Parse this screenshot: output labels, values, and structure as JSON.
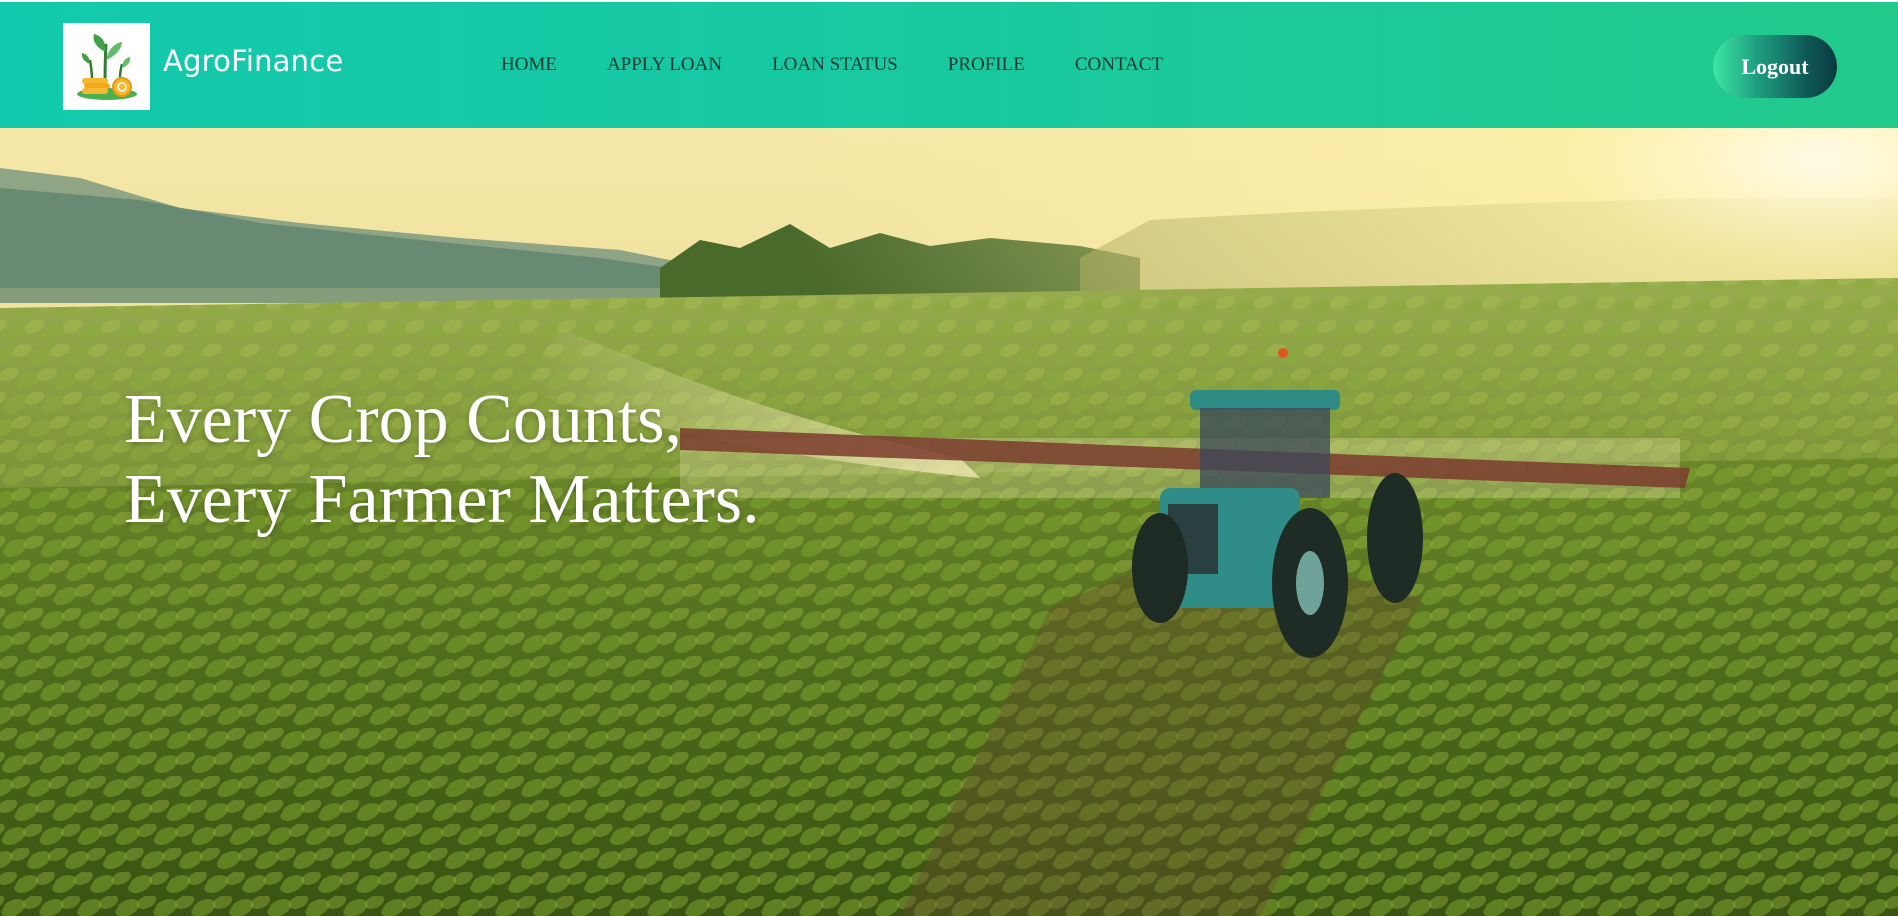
{
  "brand": {
    "name": "AgroFinance",
    "logo_icon": "plant-coins-icon"
  },
  "nav": {
    "items": [
      {
        "label": "HOME"
      },
      {
        "label": "APPLY LOAN"
      },
      {
        "label": "LOAN STATUS"
      },
      {
        "label": "PROFILE"
      },
      {
        "label": "CONTACT"
      }
    ]
  },
  "header": {
    "logout_label": "Logout"
  },
  "hero": {
    "line1": "Every Crop Counts,",
    "line2": "Every Farmer Matters.",
    "image_subject": "tractor-spraying-crop-field"
  },
  "colors": {
    "navbar_start": "#13c9ad",
    "navbar_end": "#22c98b",
    "nav_text": "#1b3a2f",
    "hero_text": "#ffffff"
  }
}
